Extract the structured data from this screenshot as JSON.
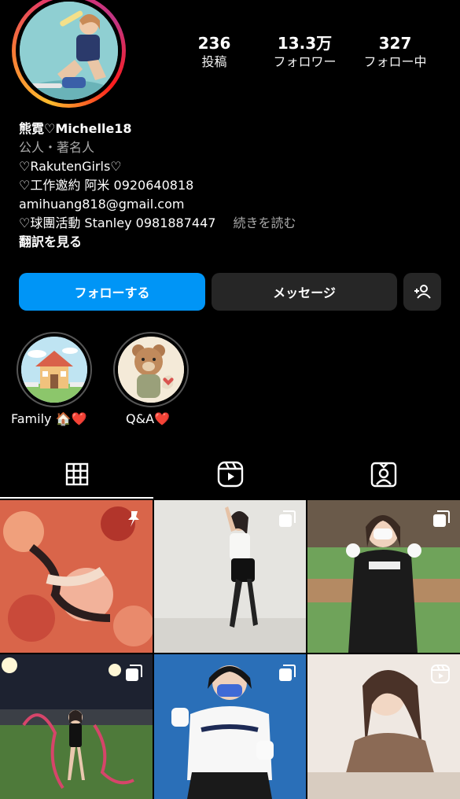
{
  "profile": {
    "name": "熊霓♡Michelle18",
    "category": "公人・著名人",
    "bio_lines": [
      "♡RakutenGirls♡",
      "♡工作邀約 阿米 0920640818",
      "amihuang818@gmail.com",
      "♡球團活動 Stanley 0981887447"
    ],
    "more_label": "続きを読む",
    "translate_label": "翻訳を見る"
  },
  "stats": [
    {
      "value": "236",
      "label": "投稿"
    },
    {
      "value": "13.3万",
      "label": "フォロワー"
    },
    {
      "value": "327",
      "label": "フォロー中"
    }
  ],
  "actions": {
    "follow_label": "フォローする",
    "message_label": "メッセージ",
    "add_user_icon": "person-plus-icon"
  },
  "highlights": [
    {
      "label": "Family 🏠❤️",
      "icon": "house"
    },
    {
      "label": "Q&A❤️",
      "icon": "teddy-bear"
    }
  ],
  "tabs": [
    {
      "icon": "grid-icon",
      "active": true
    },
    {
      "icon": "reels-icon",
      "active": false
    },
    {
      "icon": "tagged-icon",
      "active": false
    }
  ],
  "posts": [
    {
      "badge": "pin-icon"
    },
    {
      "badge": "carousel-icon"
    },
    {
      "badge": "carousel-icon"
    },
    {
      "badge": "carousel-icon"
    },
    {
      "badge": "carousel-icon"
    },
    {
      "badge": "reels-icon"
    }
  ],
  "colors": {
    "background": "#000000",
    "follow_button": "#0095f6",
    "secondary_button": "#262626",
    "muted_text": "#a8a8a8"
  }
}
